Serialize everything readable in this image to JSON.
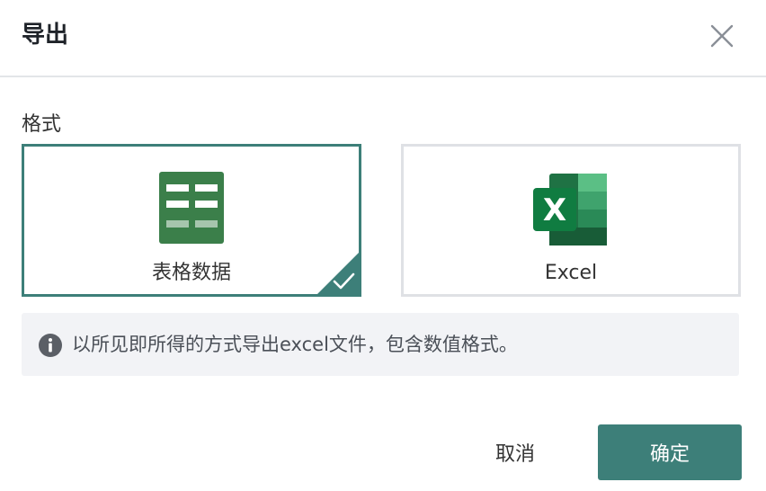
{
  "dialog": {
    "title": "导出",
    "close_icon": "close-icon"
  },
  "format": {
    "label": "格式",
    "options": [
      {
        "label": "表格数据",
        "icon": "table-data-icon",
        "selected": true
      },
      {
        "label": "Excel",
        "icon": "excel-icon",
        "selected": false
      }
    ]
  },
  "info": {
    "icon": "info-icon",
    "text": "以所见即所得的方式导出excel文件，包含数值格式。"
  },
  "footer": {
    "cancel_label": "取消",
    "confirm_label": "确定"
  },
  "colors": {
    "primary": "#3d7f79",
    "table_icon_green": "#3b7f4a",
    "border_unselected": "#dfe1e5",
    "info_bg": "#f2f3f6",
    "info_icon": "#5b5f66"
  }
}
